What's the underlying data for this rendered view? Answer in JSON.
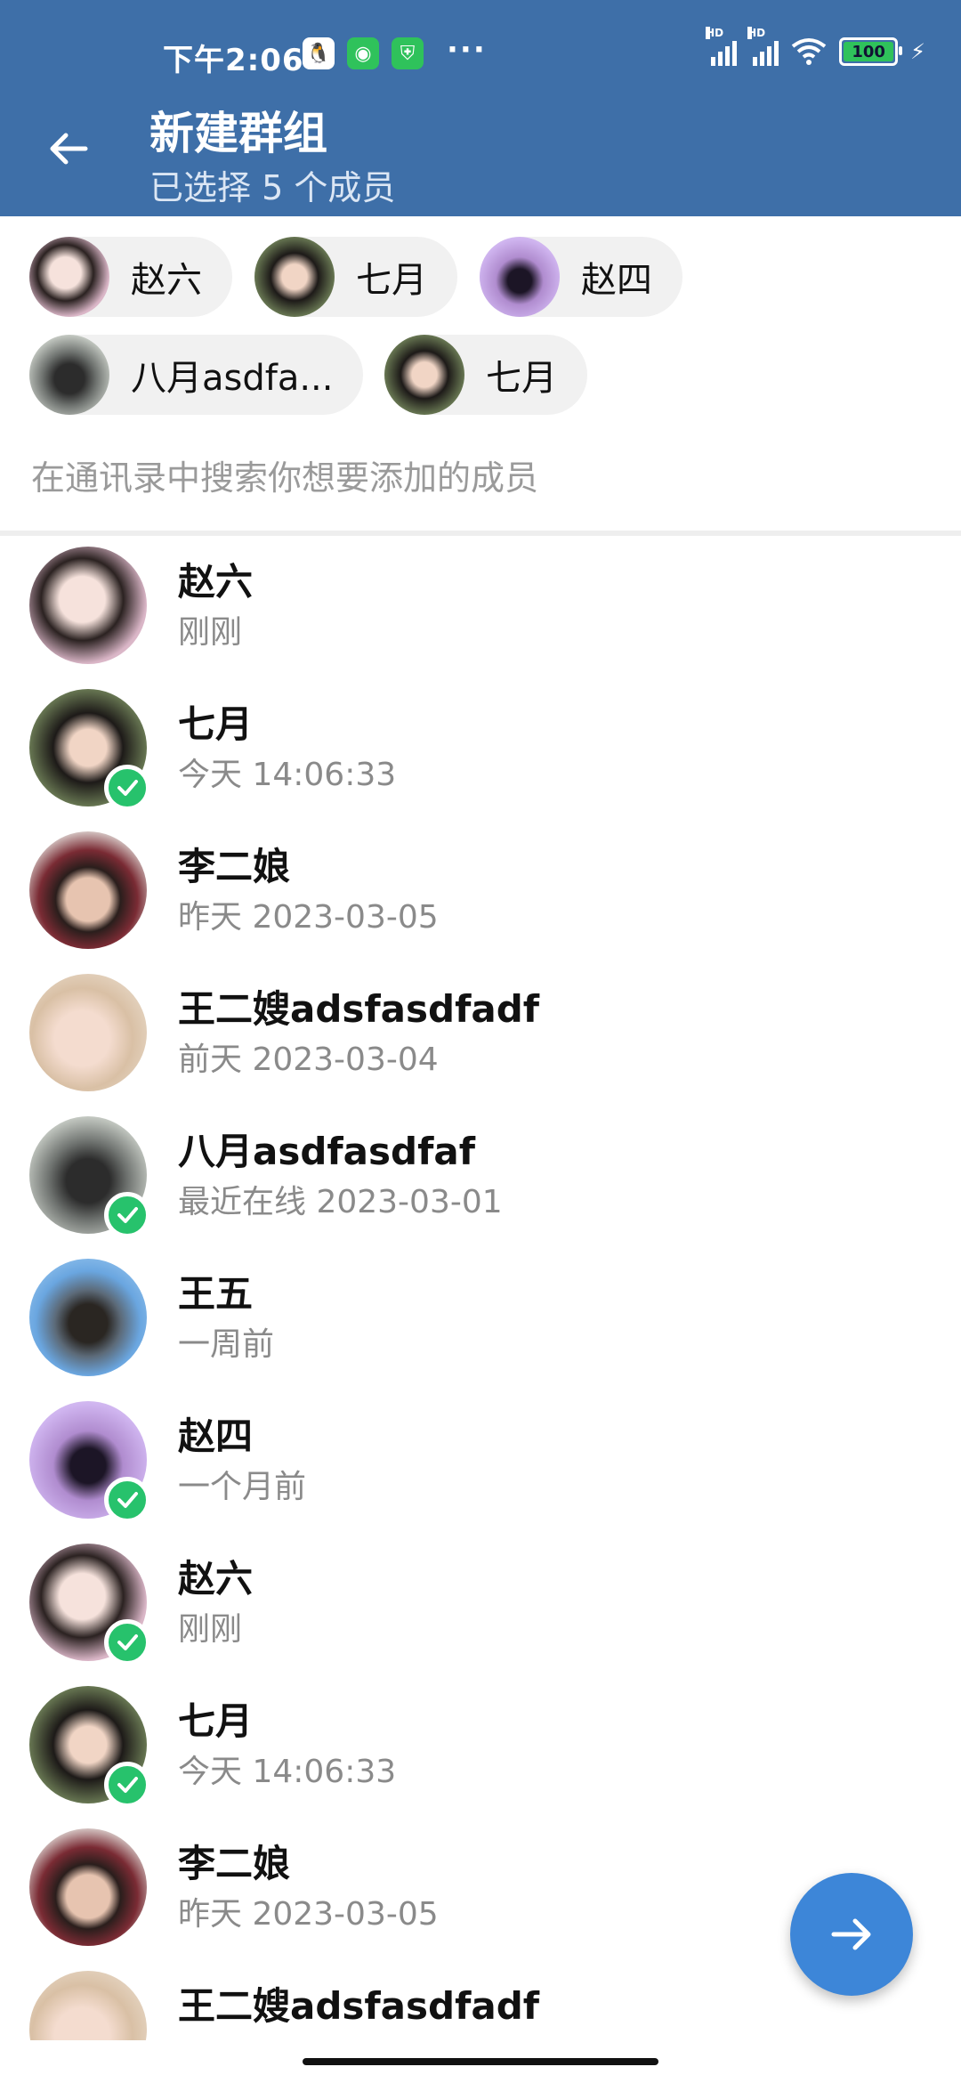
{
  "status_bar": {
    "time": "下午2:06",
    "battery": "100",
    "hd1": "HD",
    "hd2": "HD",
    "app_icons": [
      "qq-icon",
      "wechat-icon",
      "shield-icon"
    ]
  },
  "header": {
    "title": "新建群组",
    "subtitle": "已选择 5 个成员"
  },
  "selected_chips": [
    {
      "name": "赵六",
      "avatar": "a1"
    },
    {
      "name": "七月",
      "avatar": "a2"
    },
    {
      "name": "赵四",
      "avatar": "a7"
    },
    {
      "name": "八月asdfa...",
      "avatar": "a5"
    },
    {
      "name": "七月",
      "avatar": "a2"
    }
  ],
  "search": {
    "placeholder": "在通讯录中搜索你想要添加的成员"
  },
  "contacts": [
    {
      "name": "赵六",
      "status": "刚刚",
      "selected": false,
      "avatar": "a1"
    },
    {
      "name": "七月",
      "status": "今天 14:06:33",
      "selected": true,
      "avatar": "a2"
    },
    {
      "name": "李二娘",
      "status": "昨天 2023-03-05",
      "selected": false,
      "avatar": "a3"
    },
    {
      "name": "王二嫂adsfasdfadf",
      "status": "前天 2023-03-04",
      "selected": false,
      "avatar": "a4"
    },
    {
      "name": "八月asdfasdfaf",
      "status": "最近在线 2023-03-01",
      "selected": true,
      "avatar": "a5"
    },
    {
      "name": "王五",
      "status": "一周前",
      "selected": false,
      "avatar": "a6"
    },
    {
      "name": "赵四",
      "status": "一个月前",
      "selected": true,
      "avatar": "a7"
    },
    {
      "name": "赵六",
      "status": "刚刚",
      "selected": true,
      "avatar": "a1"
    },
    {
      "name": "七月",
      "status": "今天 14:06:33",
      "selected": true,
      "avatar": "a2"
    },
    {
      "name": "李二娘",
      "status": "昨天 2023-03-05",
      "selected": false,
      "avatar": "a3"
    },
    {
      "name": "王二嫂adsfasdfadf",
      "status": "",
      "selected": false,
      "avatar": "a4"
    }
  ],
  "colors": {
    "header_bg": "#3e6fa8",
    "check": "#27c26c",
    "fab": "#3d86d8"
  }
}
